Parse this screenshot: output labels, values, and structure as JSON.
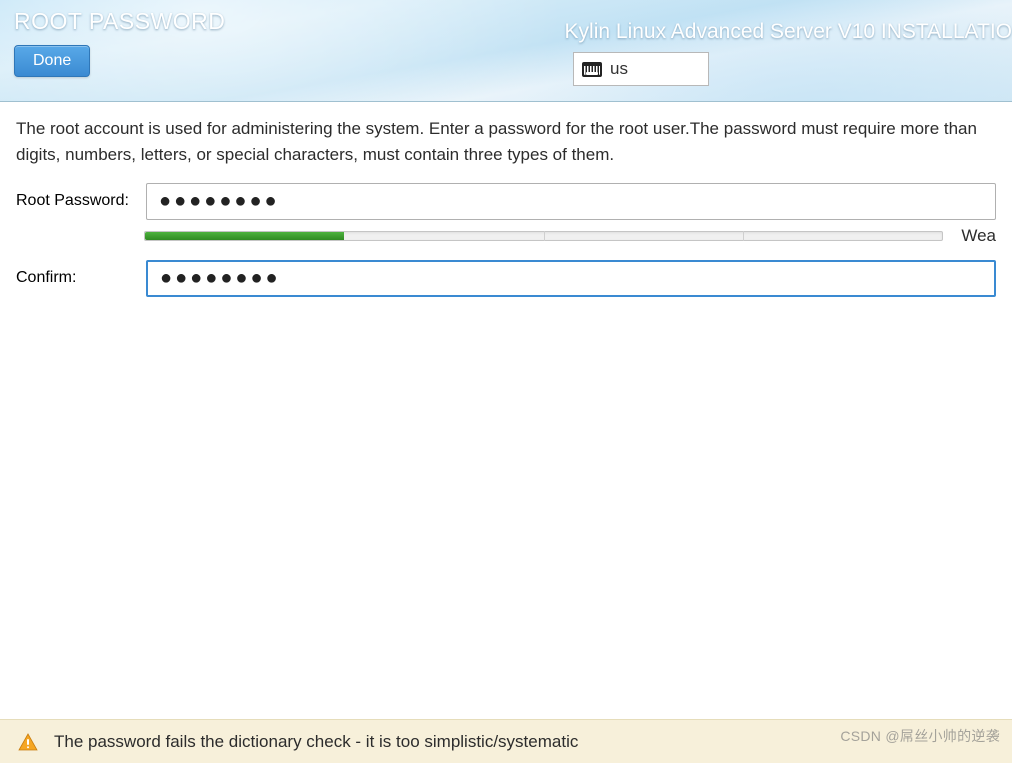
{
  "header": {
    "page_title": "ROOT PASSWORD",
    "done_label": "Done",
    "installer_title": "Kylin Linux Advanced Server V10 INSTALLATIO",
    "keyboard_layout": "us"
  },
  "content": {
    "description": "The root account is used for administering the system.  Enter a password for the root user.The password must require more than digits, numbers, letters, or special characters, must contain three types of them.",
    "root_password_label": "Root Password:",
    "confirm_label": "Confirm:",
    "root_password_value": "●●●●●●●●",
    "confirm_value": "●●●●●●●●",
    "strength_label": "Wea",
    "strength_percent": 25
  },
  "warning": {
    "text": "The password fails the dictionary check - it is too simplistic/systematic"
  },
  "watermark": "CSDN @屌丝小帅的逆袭"
}
